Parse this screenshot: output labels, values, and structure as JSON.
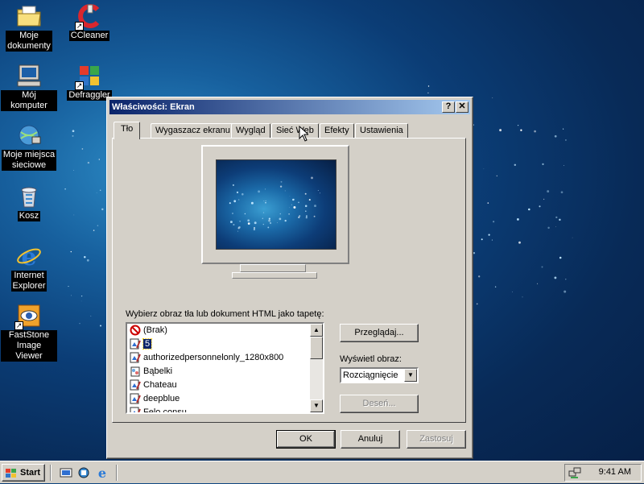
{
  "desktop": {
    "icons": [
      {
        "label": "Moje\ndokumenty",
        "icon": "folder-documents-icon"
      },
      {
        "label": "CCleaner",
        "icon": "ccleaner-icon"
      },
      {
        "label": "Mój komputer",
        "icon": "my-computer-icon"
      },
      {
        "label": "Defraggler",
        "icon": "defraggler-icon"
      },
      {
        "label": "Moje miejsca\nsieciowe",
        "icon": "network-places-icon"
      },
      {
        "label": "Kosz",
        "icon": "recycle-bin-icon"
      },
      {
        "label": "Internet\nExplorer",
        "icon": "internet-explorer-icon"
      },
      {
        "label": "FastStone\nImage Viewer",
        "icon": "faststone-icon"
      }
    ]
  },
  "dialog": {
    "title": "Właściwości: Ekran",
    "help_label": "?",
    "close_label": "✕",
    "tabs": [
      {
        "label": "Tło",
        "active": true
      },
      {
        "label": "Wygaszacz ekranu"
      },
      {
        "label": "Wygląd"
      },
      {
        "label": "Sieć Web"
      },
      {
        "label": "Efekty"
      },
      {
        "label": "Ustawienia"
      }
    ],
    "prompt": "Wybierz obraz tła lub dokument HTML jako tapetę:",
    "wallpapers": [
      {
        "label": "(Brak)",
        "icon": "none-icon"
      },
      {
        "label": "5",
        "icon": "image-file-icon",
        "selected": true
      },
      {
        "label": "authorizedpersonnelonly_1280x800",
        "icon": "image-file-icon"
      },
      {
        "label": "Bąbelki",
        "icon": "bubbles-file-icon"
      },
      {
        "label": "Chateau",
        "icon": "image-file-icon"
      },
      {
        "label": "deepblue",
        "icon": "image-file-icon"
      },
      {
        "label": "Felo consu",
        "icon": "image-file-icon"
      }
    ],
    "browse_label": "Przeglądaj...",
    "display_label": "Wyświetl obraz:",
    "display_value": "Rozciągnięcie",
    "pattern_label": "Deseń...",
    "ok_label": "OK",
    "cancel_label": "Anuluj",
    "apply_label": "Zastosuj"
  },
  "taskbar": {
    "start_label": "Start",
    "clock": "9:41 AM",
    "quick_launch": [
      "show-desktop-icon",
      "app-icon",
      "internet-explorer-icon"
    ],
    "tray_icon": "network-tray-icon"
  },
  "colors": {
    "titlebar_start": "#0a246a",
    "titlebar_end": "#a6caf0",
    "face": "#d4d0c8",
    "selection": "#0a246a"
  }
}
